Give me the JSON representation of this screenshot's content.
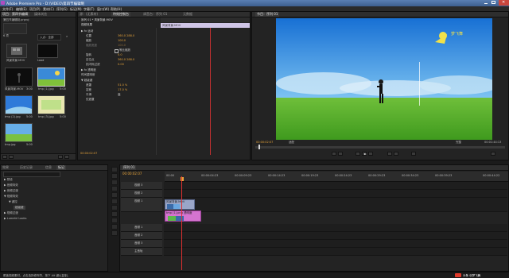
{
  "window": {
    "title": "Adobe Premiere Pro - D:\\VIDEO\\第四节编辑制",
    "minimize_icon": "minimize-icon",
    "maximize_icon": "maximize-icon",
    "close_icon": "close-icon"
  },
  "menu": [
    "文件(F)",
    "编辑(E)",
    "项目(P)",
    "素材(C)",
    "序列(S)",
    "标记(M)",
    "字幕(T)",
    "窗口(W)",
    "帮助(H)"
  ],
  "project_panel": {
    "tabs": [
      "项目：第四节编辑",
      "媒体浏览"
    ],
    "file": "第四节编辑制.prproj",
    "count": "6 项",
    "search_placeholder": "入点：全部",
    "items": [
      {
        "label": "风景背景.MOV",
        "sub": ""
      },
      {
        "label": "Load",
        "sub": ""
      },
      {
        "label": "风景背景.MOV",
        "sub": "3:00"
      },
      {
        "label": "tmp (1).jpg",
        "sub": "5:00"
      },
      {
        "label": "tmp (2).jpg",
        "sub": "5:00"
      },
      {
        "label": "tmp (3).jpg",
        "sub": "5:00"
      },
      {
        "label": "tmp.jpg",
        "sub": "5:00"
      }
    ]
  },
  "source_panel": {
    "tabs": [
      "源：(无素材)",
      "特效控制台",
      "调音台：序列 01",
      "元数据"
    ]
  },
  "effects_panel": {
    "header": "序列 01 * 风景背景.MOV",
    "clip_label": "风景背景.MOV",
    "section_video": "视频效果",
    "rows": [
      {
        "name": "▶ fx 运动",
        "val": ""
      },
      {
        "name": "位置",
        "val": "360.0   288.0"
      },
      {
        "name": "缩放",
        "val": "100.0"
      },
      {
        "name": "缩放宽度",
        "val": "100.0"
      },
      {
        "name": "等比缩放",
        "val": ""
      },
      {
        "name": "旋转",
        "val": "0.0"
      },
      {
        "name": "定位点",
        "val": "360.0   288.0"
      },
      {
        "name": "抗闪烁过滤",
        "val": "0.00"
      },
      {
        "name": "▶ fx 透明度",
        "val": ""
      },
      {
        "name": "时间重映射",
        "val": ""
      },
      {
        "name": "▼ 超级键",
        "val": ""
      },
      {
        "name": "遮罩",
        "val": "51.0 %"
      },
      {
        "name": "容差",
        "val": "17.0 %"
      },
      {
        "name": "平滑",
        "val": "高"
      },
      {
        "name": "仅遮罩",
        "val": ""
      }
    ],
    "timecode": "00:00:02:07"
  },
  "program_panel": {
    "tab": "节目：序列 01",
    "logo_text": "梦飞舞",
    "timecode_left": "00:00:02:07",
    "fit": "适配",
    "quality": "完整",
    "timecode_right": "00:01:44:13"
  },
  "bottom_left": {
    "tabs": [
      "效果",
      "历史记录",
      "信息",
      "标记"
    ],
    "search_placeholder": "",
    "tree": [
      "▶ 预设",
      "▶ 音频特效",
      "▶ 音频过渡",
      "▼ 视频特效",
      "▼ 键控",
      "超级键",
      "▶ 视频过渡",
      "▶ Lumetri Looks"
    ]
  },
  "timeline": {
    "tab": "序列 01",
    "timecode": "00:00:02:07",
    "ruler": [
      "00:00",
      "00:00:04:23",
      "00:00:09:23",
      "00:00:14:23",
      "00:00:19:23",
      "00:00:24:23",
      "00:00:29:23",
      "00:00:34:23",
      "00:00:39:23",
      "00:00:44:22"
    ],
    "video_tracks": [
      "视频 3",
      "视频 2",
      "视频 1"
    ],
    "audio_tracks": [
      "音频 1",
      "音频 2",
      "音频 3",
      "主音轨"
    ],
    "clips": [
      {
        "label": "风景背景.MOV",
        "track": "视频 2",
        "color": "#9aa6c8"
      },
      {
        "label": "tmp (1).png 透明度",
        "track": "视频 1",
        "color": "#d574d0"
      }
    ]
  },
  "status": {
    "text": "覆盖视频素材。点击选择修饰符，按下 Alt 键以复制。",
    "watermark": "头条 @梦飞舞"
  },
  "colors": {
    "accent": "#e6a33a",
    "panel": "#232323",
    "playhead": "#e03030",
    "clip_pink": "#d574d0",
    "clip_blue": "#9aa6c8"
  }
}
